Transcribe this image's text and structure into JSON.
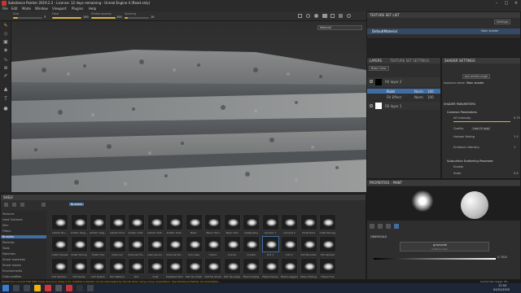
{
  "window": {
    "title": "Substance Painter 2019.2.2 - License: 12 days remaining - Unreal Engine 4 (Read only)"
  },
  "menu": [
    "File",
    "Edit",
    "Mode",
    "Window",
    "Viewport",
    "Plugins",
    "Help"
  ],
  "tool_options": {
    "size_label": "Size",
    "size_value": "3",
    "flow_label": "Flow",
    "flow_value": "100",
    "stroke_opacity_label": "Stroke opacity",
    "stroke_opacity_value": "100",
    "spacing_label": "Spacing",
    "spacing_value": "10"
  },
  "viewport": {
    "channel_select": "Material"
  },
  "texture_set_list": {
    "title": "TEXTURE SET LIST",
    "settings_label": "Settings",
    "item_name": "DefaultMaterial",
    "item_shader": "Main shader"
  },
  "layers": {
    "tab1": "LAYERS",
    "tab2": "TEXTURE SET SETTINGS",
    "channel": "Base Color",
    "items": [
      {
        "name": "Fill layer 2",
        "blend": "Norm",
        "opacity": "100"
      },
      {
        "name": "Paint",
        "blend": "Norm",
        "opacity": "100"
      },
      {
        "name": "Fill Effect",
        "blend": "Norm",
        "opacity": "100"
      },
      {
        "name": "Fill layer 1",
        "blend": "Norm",
        "opacity": "100"
      }
    ]
  },
  "shader_settings": {
    "title": "SHADER SETTINGS",
    "shader_name": "pbr-metal-rough",
    "instance_label": "Instance name",
    "instance_value": "Main shader",
    "section_params": "SHADER PARAMETERS",
    "common_params": "Common Parameters",
    "ao_label": "AO Intensity",
    "ao_value": "0.75",
    "quality_label": "Quality",
    "quality_value": "Low (4 spp)",
    "horizon_label": "Horizon Fading",
    "horizon_value": "1.3",
    "emissive_label": "Emissive Intensity",
    "emissive_value": "1",
    "sss_section": "Subsurface Scattering Paramete",
    "enable_label": "Enable",
    "scale_label": "Scale",
    "scale_value": "0.5"
  },
  "properties": {
    "title": "PROPERTIES - PAINT",
    "section": "GRAYSCALE",
    "source": "grayscale",
    "uniform": "uniform color",
    "value": "0.7820"
  },
  "shelf": {
    "title": "SHELF",
    "filter": "Brushes",
    "categories": [
      "Textures",
      "Hard Surfaces",
      "Skin",
      "Filters",
      "Brushes",
      "Particles",
      "Tools",
      "Materials",
      "Smart materials",
      "Smart masks",
      "Environments",
      "Color profiles"
    ],
    "selected_category": "Brushes",
    "rows": [
      [
        "Artistic Bru...",
        "Artistic Heig...",
        "Artistic Heig...",
        "Artistic Print",
        "Artistic Soft...",
        "Artistic Soft...",
        "Artistic Soft...",
        "Basic",
        "Basic Hard",
        "Basic Soft",
        "Calligraphy",
        "Cement 1",
        "Cement 2",
        "Chalk Bold",
        "Chalk Bumpy"
      ],
      [
        "Chalk Spread",
        "Chalk Strong",
        "Chalk Thin",
        "Charcoal",
        "Charcoal Fin...",
        "Charcoal Lin...",
        "Charcoal No...",
        "Concrete",
        "Cotton",
        "Cracks",
        "Crystal",
        "Dirt 1",
        "Dirt 2",
        "Dirt Brushed",
        "Dirt Spread"
      ],
      [
        "Dirt Spread...",
        "Dirt Spots",
        "Dirt Splash",
        "Dirt Wetline",
        "Dot",
        "Dust",
        "Elephant Skin",
        "Felt Tip Small",
        "Felt Tip Small",
        "Felt Tip Large",
        "Fibers Fading",
        "Fibers Dense",
        "Fibers Lagged",
        "Fibers Fading",
        "Fibers Fine"
      ]
    ]
  },
  "status": {
    "message": "[Shell] Your current TDR (GPU hang recovery) delay is 2s. Substance Painter can be interrupted by the OS when using a long computation. See Substance Painter documentation...",
    "right": "Cache Disk Usage: 0%"
  },
  "taskbar": {
    "time": "12:50",
    "date": "04/01/2020"
  },
  "colors": {
    "accent": "#d8b040",
    "selection": "#3d6ea8",
    "panel_bg": "#2e2e2e"
  }
}
